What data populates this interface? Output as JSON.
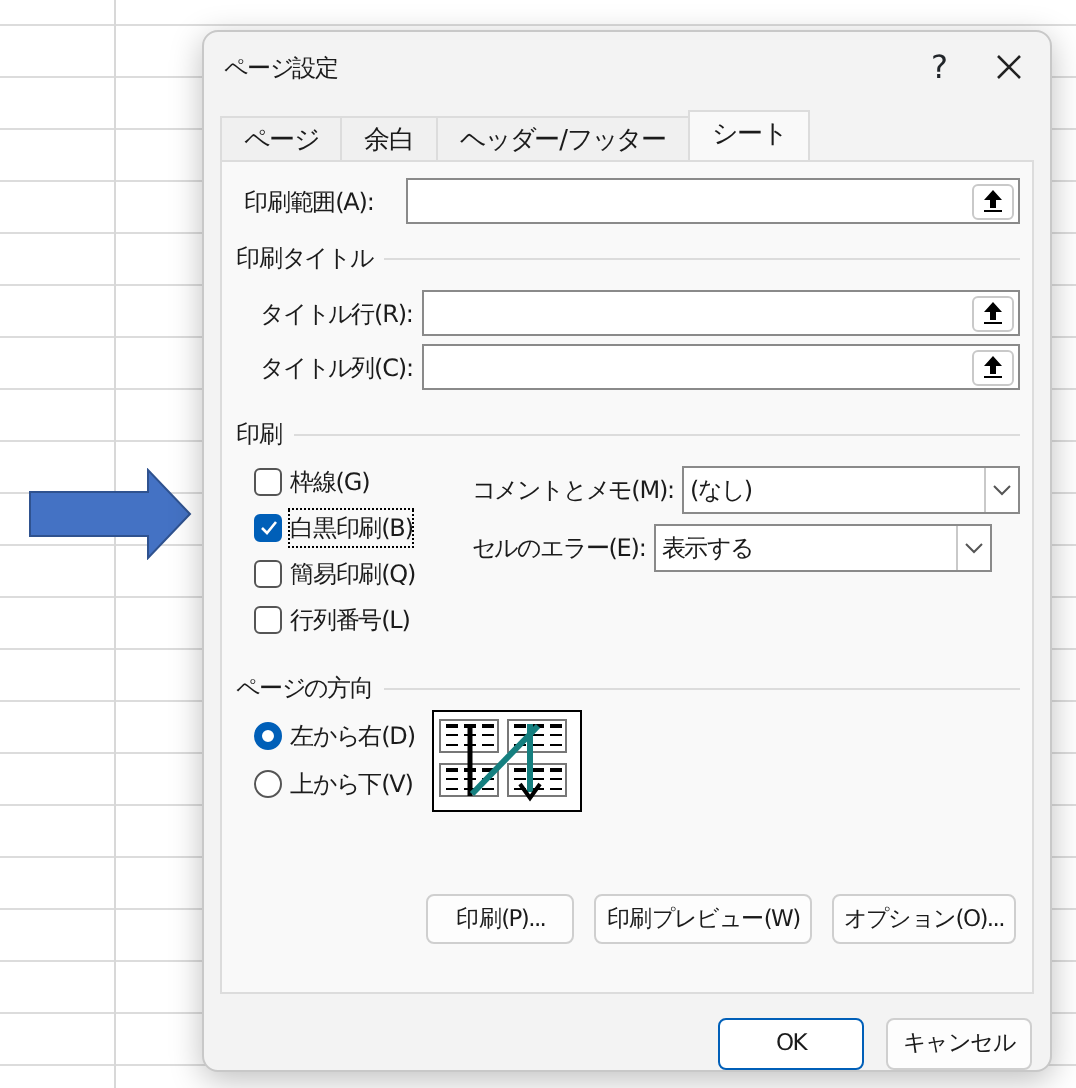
{
  "window": {
    "title": "ページ設定",
    "help": "?"
  },
  "tabs": [
    {
      "label": "ページ",
      "selected": false
    },
    {
      "label": "余白",
      "selected": false
    },
    {
      "label": "ヘッダー/フッター",
      "selected": false
    },
    {
      "label": "シート",
      "selected": true
    }
  ],
  "print_area": {
    "label": "印刷範囲(A):"
  },
  "print_titles": {
    "heading": "印刷タイトル",
    "fields": [
      {
        "label": "タイトル行(R):"
      },
      {
        "label": "タイトル列(C):"
      }
    ]
  },
  "print": {
    "heading": "印刷",
    "options": [
      {
        "label": "枠線(G)",
        "checked": false,
        "focused": false
      },
      {
        "label": "白黒印刷(B)",
        "checked": true,
        "focused": true
      },
      {
        "label": "簡易印刷(Q)",
        "checked": false,
        "focused": false
      },
      {
        "label": "行列番号(L)",
        "checked": false,
        "focused": false
      }
    ],
    "dropdowns": [
      {
        "label": "コメントとメモ(M):",
        "value": "(なし)"
      },
      {
        "label": "セルのエラー(E):",
        "value": "表示する"
      }
    ]
  },
  "page_order": {
    "heading": "ページの方向",
    "options": [
      {
        "label": "左から右(D)",
        "selected": true
      },
      {
        "label": "上から下(V)",
        "selected": false
      }
    ]
  },
  "panel_buttons": [
    {
      "label": "印刷(P)..."
    },
    {
      "label": "印刷プレビュー(W)"
    },
    {
      "label": "オプション(O)..."
    }
  ],
  "dialog_buttons": [
    {
      "label": "OK",
      "default": true
    },
    {
      "label": "キャンセル",
      "default": false
    }
  ]
}
